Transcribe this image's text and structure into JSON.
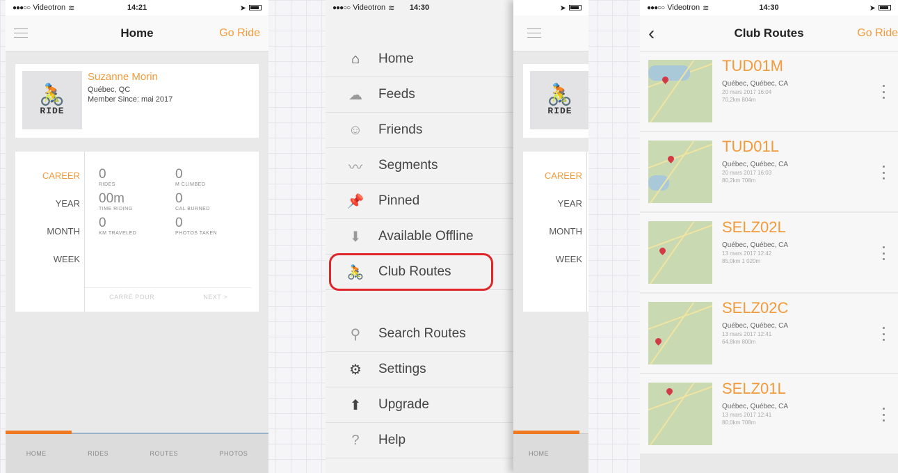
{
  "status": {
    "carrier": "Videotron",
    "time_p1": "14:21",
    "time_p2": "14:30",
    "time_p3": "14:30"
  },
  "home": {
    "title": "Home",
    "go_ride": "Go Ride",
    "logo_text": "RIDE",
    "profile": {
      "name": "Suzanne Morin",
      "location": "Québec, QC",
      "member_since": "Member Since: mai 2017"
    },
    "periods": [
      "CAREER",
      "YEAR",
      "MONTH",
      "WEEK"
    ],
    "stats": [
      {
        "value": "0",
        "label": "RIDES"
      },
      {
        "value": "0",
        "label": "M CLIMBED"
      },
      {
        "value": "00m",
        "label": "TIME RIDING"
      },
      {
        "value": "0",
        "label": "CAL BURNED"
      },
      {
        "value": "0",
        "label": "KM TRAVELED"
      },
      {
        "value": "0",
        "label": "PHOTOS TAKEN"
      }
    ],
    "footer": {
      "left": "CARRÉ POUR",
      "right": "NEXT >"
    },
    "tabs": [
      "HOME",
      "RIDES",
      "ROUTES",
      "PHOTOS"
    ]
  },
  "menu": {
    "items": [
      {
        "label": "Home",
        "icon": "home-icon"
      },
      {
        "label": "Feeds",
        "icon": "cloud-icon"
      },
      {
        "label": "Friends",
        "icon": "friends-icon"
      },
      {
        "label": "Segments",
        "icon": "segments-icon"
      },
      {
        "label": "Pinned",
        "icon": "pin-icon"
      },
      {
        "label": "Available Offline",
        "icon": "offline-icon"
      },
      {
        "label": "Club Routes",
        "icon": "club-routes-icon"
      }
    ],
    "items2": [
      {
        "label": "Search Routes",
        "icon": "search-icon"
      },
      {
        "label": "Settings",
        "icon": "gear-icon"
      },
      {
        "label": "Upgrade",
        "icon": "upgrade-icon"
      },
      {
        "label": "Help",
        "icon": "help-icon"
      }
    ],
    "peek_periods": [
      "CAREER",
      "YEAR",
      "MONTH",
      "WEEK"
    ],
    "peek_logo": "RIDE",
    "peek_tab": "HOME",
    "highlight_color": "#e0262a"
  },
  "club_routes": {
    "title": "Club Routes",
    "go_ride": "Go Ride",
    "routes": [
      {
        "code": "TUD01M",
        "location": "Québec, Québec, CA",
        "date": "20 mars 2017 16:04",
        "stats": "70,2km    804m"
      },
      {
        "code": "TUD01L",
        "location": "Québec, Québec, CA",
        "date": "20 mars 2017 16:03",
        "stats": "80,2km    708m"
      },
      {
        "code": "SELZ02L",
        "location": "Québec, Québec, CA",
        "date": "13 mars 2017 12:42",
        "stats": "85,0km    1 020m"
      },
      {
        "code": "SELZ02C",
        "location": "Québec, Québec, CA",
        "date": "13 mars 2017 12:41",
        "stats": "64,8km    800m"
      },
      {
        "code": "SELZ01L",
        "location": "Québec, Québec, CA",
        "date": "13 mars 2017 12:41",
        "stats": "80,0km    708m"
      }
    ]
  },
  "colors": {
    "accent": "#f29a3a",
    "tab_indicator": "#f07a22"
  }
}
